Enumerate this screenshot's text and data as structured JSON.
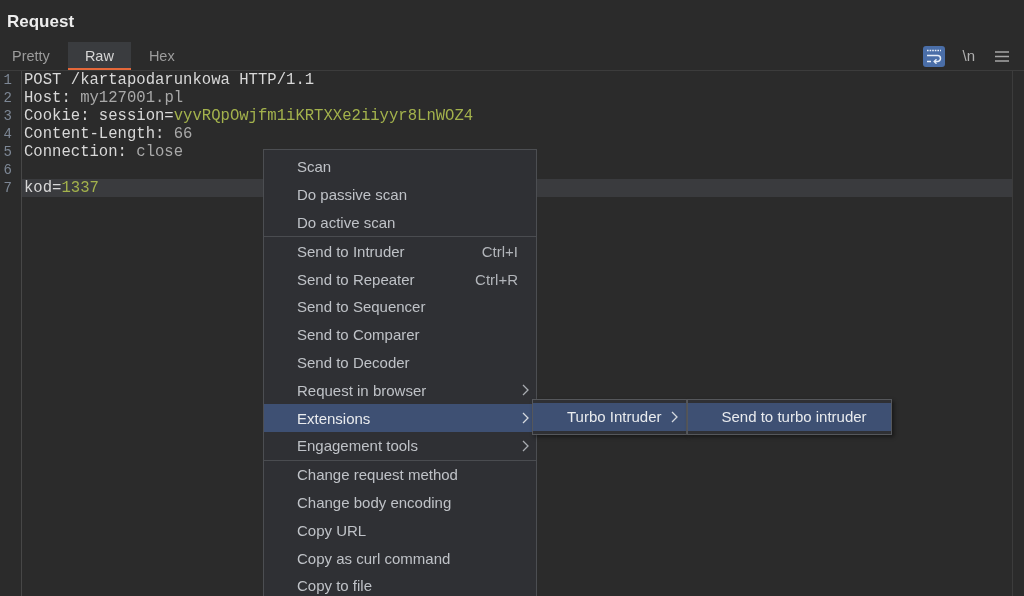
{
  "panel": {
    "title": "Request"
  },
  "tabs": [
    {
      "label": "Pretty",
      "selected": false
    },
    {
      "label": "Raw",
      "selected": true
    },
    {
      "label": "Hex",
      "selected": false
    }
  ],
  "toolbar": [
    {
      "kind": "wrap",
      "on": true
    },
    {
      "kind": "text",
      "label": "\\n",
      "on": false
    },
    {
      "kind": "menu"
    }
  ],
  "editor": {
    "lines": [
      {
        "number": "1",
        "current": false,
        "segments": [
          {
            "kind": "plain",
            "text": "POST /kartapodarunkowa HTTP/1.1"
          }
        ]
      },
      {
        "number": "2",
        "current": false,
        "segments": [
          {
            "kind": "plain",
            "text": "Host: "
          },
          {
            "kind": "value",
            "text": "my127001.pl"
          }
        ]
      },
      {
        "number": "3",
        "current": false,
        "segments": [
          {
            "kind": "plain",
            "text": "Cookie: session="
          },
          {
            "kind": "param",
            "text": "vyvRQpOwjfm1iKRTXXe2iiyyr8LnWOZ4"
          }
        ]
      },
      {
        "number": "4",
        "current": false,
        "segments": [
          {
            "kind": "plain",
            "text": "Content-Length: "
          },
          {
            "kind": "value",
            "text": "66"
          }
        ]
      },
      {
        "number": "5",
        "current": false,
        "segments": [
          {
            "kind": "plain",
            "text": "Connection: "
          },
          {
            "kind": "value",
            "text": "close"
          }
        ]
      },
      {
        "number": "6",
        "current": false
      },
      {
        "number": "7",
        "current": true,
        "segments": [
          {
            "kind": "plain",
            "text": "kod="
          },
          {
            "kind": "param",
            "text": "1337"
          }
        ]
      }
    ]
  },
  "context_menu": {
    "groups": [
      {
        "items": [
          {
            "label": "Scan",
            "has_submenu": false,
            "selected": false
          },
          {
            "label": "Do passive scan",
            "has_submenu": false,
            "selected": false
          },
          {
            "label": "Do active scan",
            "has_submenu": false,
            "selected": false
          }
        ]
      },
      {
        "items": [
          {
            "label": "Send to Intruder",
            "shortcut": "Ctrl+I",
            "has_submenu": false,
            "selected": false
          },
          {
            "label": "Send to Repeater",
            "shortcut": "Ctrl+R",
            "has_submenu": false,
            "selected": false
          },
          {
            "label": "Send to Sequencer",
            "has_submenu": false,
            "selected": false
          },
          {
            "label": "Send to Comparer",
            "has_submenu": false,
            "selected": false
          },
          {
            "label": "Send to Decoder",
            "has_submenu": false,
            "selected": false
          },
          {
            "label": "Request in browser",
            "has_submenu": true,
            "selected": false
          },
          {
            "label": "Extensions",
            "has_submenu": true,
            "selected": true
          },
          {
            "label": "Engagement tools",
            "has_submenu": true,
            "selected": false
          }
        ]
      },
      {
        "items": [
          {
            "label": "Change request method",
            "has_submenu": false,
            "selected": false
          },
          {
            "label": "Change body encoding",
            "has_submenu": false,
            "selected": false
          },
          {
            "label": "Copy URL",
            "has_submenu": false,
            "selected": false
          },
          {
            "label": "Copy as curl command",
            "has_submenu": false,
            "selected": false
          },
          {
            "label": "Copy to file",
            "has_submenu": false,
            "selected": false
          }
        ]
      }
    ]
  },
  "submenus": [
    {
      "items": [
        {
          "label": "Turbo Intruder",
          "has_submenu": true,
          "selected": true
        }
      ]
    },
    {
      "items": [
        {
          "label": "Send to turbo intruder",
          "has_submenu": false,
          "selected": true
        }
      ]
    }
  ]
}
